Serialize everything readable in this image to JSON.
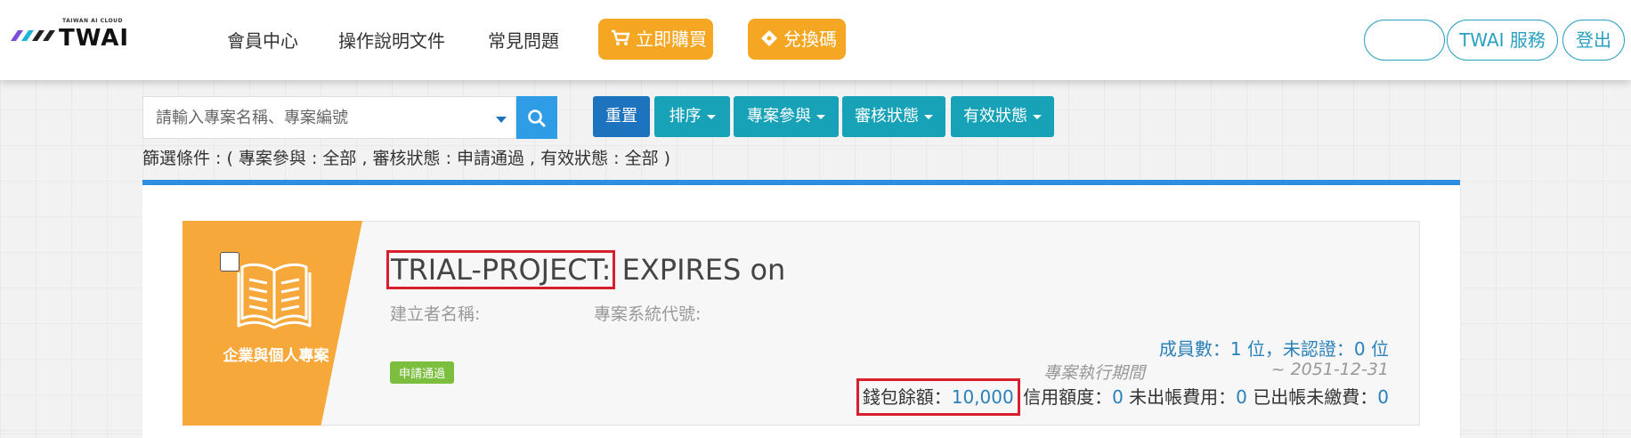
{
  "brand": {
    "name": "TWAI",
    "tagline": "TAIWAN AI CLOUD"
  },
  "nav": {
    "links": [
      "會員中心",
      "操作說明文件",
      "常見問題"
    ],
    "buy_label": "立即購買",
    "redeem_label": "兌換碼",
    "user_label": "",
    "services_label": "TWAI 服務",
    "logout_label": "登出"
  },
  "search": {
    "placeholder": "請輸入專案名稱、專案編號",
    "value": ""
  },
  "toolbar": {
    "reset_label": "重置",
    "sort_label": "排序",
    "participation_label": "專案參與",
    "review_label": "審核狀態",
    "validity_label": "有效狀態"
  },
  "filter_text": "篩選條件 : ( 專案參與 : 全部 , 審核狀態 : 申請通過 , 有效狀態 : 全部 )",
  "project": {
    "category": "企業與個人專案",
    "title_prefix": "TRIAL-PROJECT:",
    "title_suffix": " EXPIRES on",
    "creator_label": "建立者名稱:",
    "system_code_label": "專案系統代號:",
    "status_badge": "申請通過",
    "members_text": "成員數：1 位，未認證：0 位",
    "period_label": "專案執行期間",
    "period_value": "~ 2051-12-31",
    "wallet_label": "錢包餘額：",
    "wallet_value": "10,000",
    "credit_label": " 信用額度：",
    "credit_value": "0",
    "unbilled_label": " 未出帳費用：",
    "unbilled_value": "0",
    "unpaid_label": " 已出帳未繳費：",
    "unpaid_value": "0"
  },
  "colors": {
    "orange": "#f5a623",
    "teal": "#17a2b8",
    "blue_dark": "#1e73be",
    "blue_search": "#2f9ce6",
    "highlight_red": "#d8202c",
    "badge_green": "#7cbf3f"
  }
}
